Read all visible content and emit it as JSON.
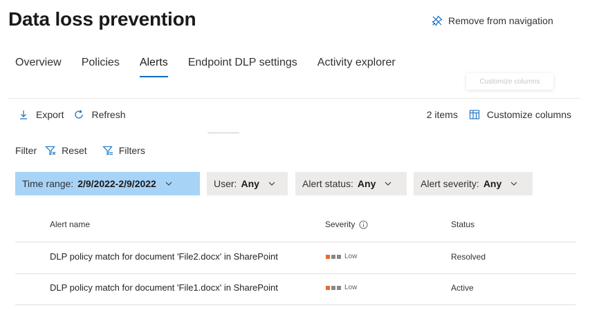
{
  "header": {
    "title": "Data loss prevention",
    "remove_nav": "Remove from navigation"
  },
  "tabs": [
    {
      "label": "Overview"
    },
    {
      "label": "Policies"
    },
    {
      "label": "Alerts",
      "active": true
    },
    {
      "label": "Endpoint DLP settings"
    },
    {
      "label": "Activity explorer"
    }
  ],
  "tooltip": {
    "text": "Customize columns"
  },
  "toolbar": {
    "export_label": "Export",
    "refresh_label": "Refresh",
    "item_count": "2 items",
    "customize_label": "Customize columns"
  },
  "filter": {
    "label": "Filter",
    "reset_label": "Reset",
    "filters_label": "Filters"
  },
  "pills": [
    {
      "label": "Time range:",
      "value": "2/9/2022-2/9/2022"
    },
    {
      "label": "User:",
      "value": "Any"
    },
    {
      "label": "Alert status:",
      "value": "Any"
    },
    {
      "label": "Alert severity:",
      "value": "Any"
    }
  ],
  "table": {
    "columns": {
      "name": "Alert name",
      "severity": "Severity",
      "status": "Status"
    },
    "rows": [
      {
        "name": "DLP policy match for document 'File2.docx' in SharePoint",
        "severity": "Low",
        "status": "Resolved"
      },
      {
        "name": "DLP policy match for document 'File1.docx' in SharePoint",
        "severity": "Low",
        "status": "Active"
      }
    ]
  },
  "colors": {
    "accent": "#0f6cbd",
    "active_pill": "#a7d3f7",
    "severity_low_filled": "#e8692f",
    "severity_empty": "#8a8886"
  }
}
